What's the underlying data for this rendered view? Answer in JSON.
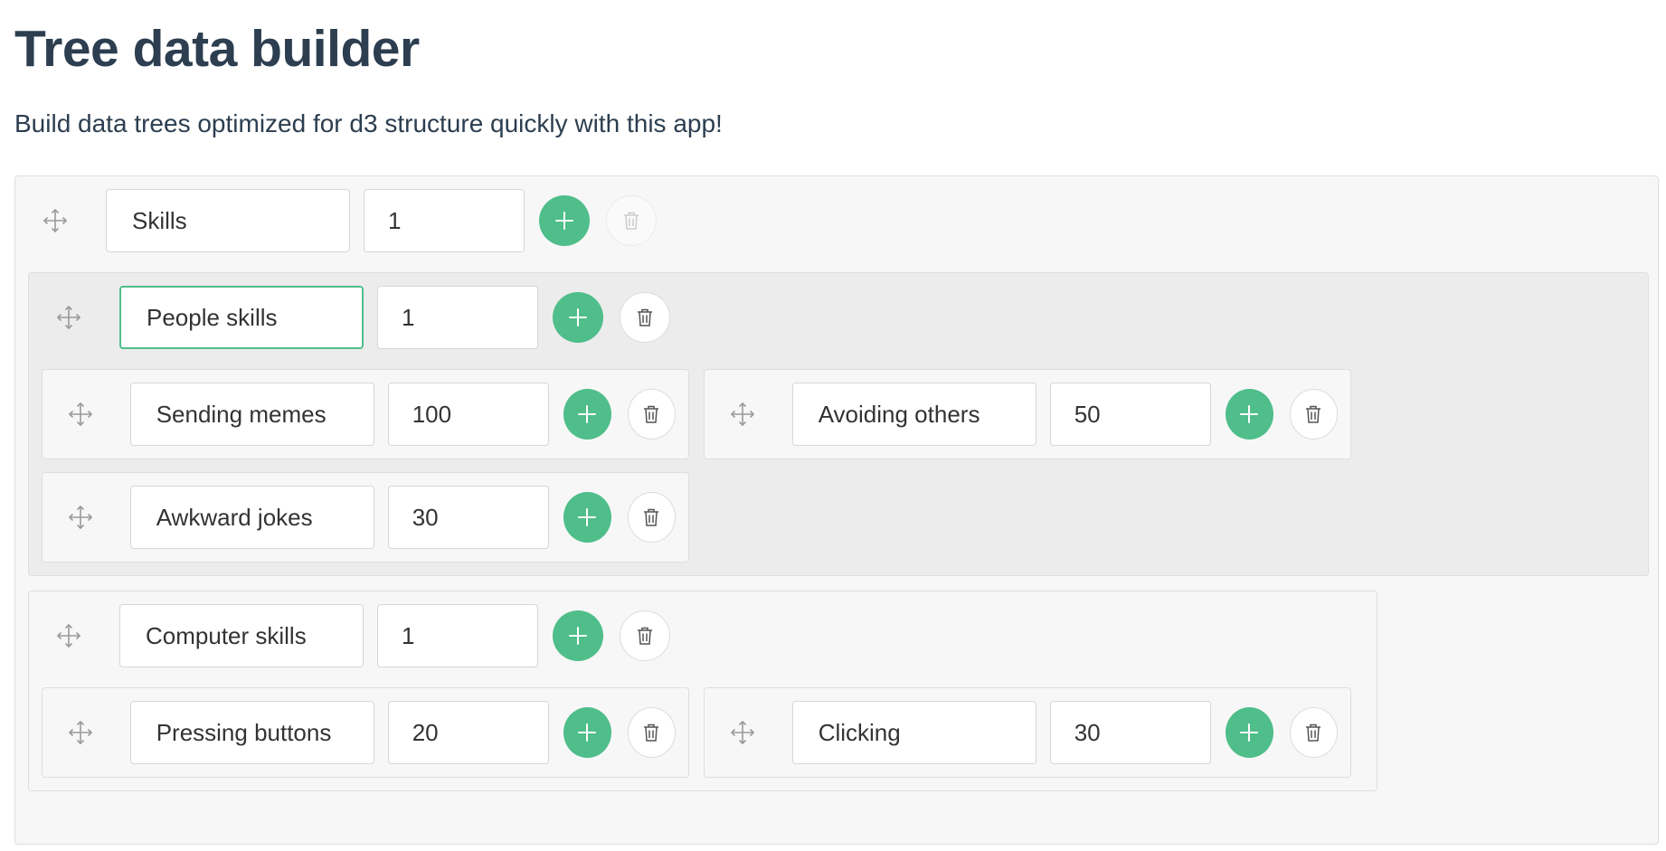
{
  "header": {
    "title": "Tree data builder",
    "subtitle": "Build data trees optimized for d3 structure quickly with this app!"
  },
  "colors": {
    "accent": "#4fbe8a",
    "text": "#2c3e50",
    "panel": "#f7f7f7",
    "panel_active": "#ececec"
  },
  "icons": {
    "drag": "move-arrows-icon",
    "add": "plus-icon",
    "delete": "trash-icon"
  },
  "tree": {
    "root": {
      "name": "Skills",
      "value": "1"
    },
    "people": {
      "name": "People skills",
      "value": "1"
    },
    "sending_memes": {
      "name": "Sending memes",
      "value": "100"
    },
    "avoiding_others": {
      "name": "Avoiding others",
      "value": "50"
    },
    "awkward_jokes": {
      "name": "Awkward jokes",
      "value": "30"
    },
    "computer": {
      "name": "Computer skills",
      "value": "1"
    },
    "pressing_buttons": {
      "name": "Pressing buttons",
      "value": "20"
    },
    "clicking": {
      "name": "Clicking",
      "value": "30"
    }
  }
}
